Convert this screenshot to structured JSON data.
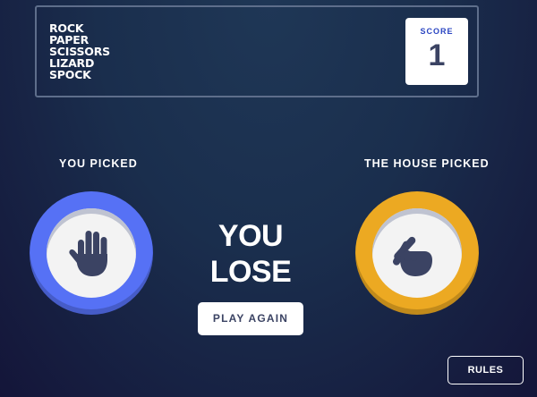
{
  "header": {
    "logo_lines": [
      "ROCK",
      "PAPER",
      "SCISSORS",
      "LIZARD",
      "SPOCK"
    ],
    "score_label": "SCORE",
    "score_value": "1"
  },
  "game": {
    "player_label": "YOU PICKED",
    "house_label": "THE HOUSE PICKED",
    "player_pick": {
      "icon": "hand-paper-icon",
      "ring_color": "#5671f5"
    },
    "house_pick": {
      "icon": "hand-scissors-icon",
      "ring_color": "#eca922"
    },
    "result_text": "YOU LOSE",
    "play_again_label": "PLAY AGAIN"
  },
  "footer": {
    "rules_label": "RULES"
  },
  "colors": {
    "background": "#1f3756",
    "icon": "#3b4363",
    "score_label": "#2a45c2"
  }
}
